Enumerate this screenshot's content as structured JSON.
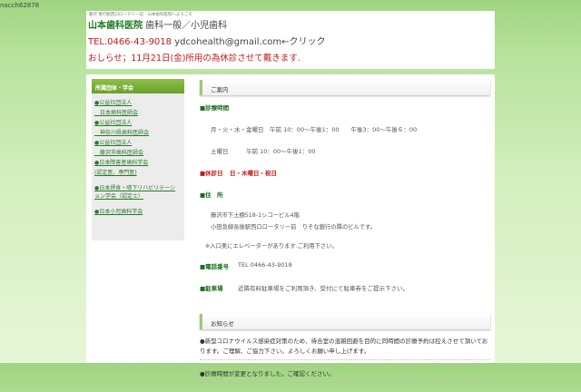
{
  "username": "nacch62878",
  "header": {
    "tagline": "藤沢 善行駅西口ロータリー前　山本歯科医院へようこそ",
    "clinic_name": "山本歯科医院",
    "clinic_sub": " 歯科一般／小児歯科",
    "tel": "TEL.0466-43-9018",
    "email": "ydcohealth@gmail.com←クリック",
    "notice": "おしらせ；11月21日(金)所用の為休診させて戴きます."
  },
  "sidebar": {
    "title": "所属団体・学会",
    "items": [
      "●公益社団法人",
      "　日本歯科医師会",
      "●公益社団法人",
      "　神奈川県歯科医師会",
      "●公益社団法人",
      "　藤沢市歯科医師会",
      "●日本障害者歯科学会",
      "(認定医、専門医)",
      "●日本摂食・嚥下リハビリテーション学会（認定士）",
      "●日本小児歯科学会"
    ]
  },
  "guide": {
    "title": "ご案内",
    "hours_label": "■診療時間",
    "hours": [
      "月・火・水・金曜日　午前 10：00〜午後1：00　　午後3：00〜午後６：00",
      "土曜日　　　午前 10：00〜午後1：00"
    ],
    "holiday_label": "■休診日",
    "holiday": "日・木曜日・祝日",
    "address_label": "■住　所",
    "address": [
      "藤沢市下土棚518-1シコービル4階",
      "小田急線長後駅西口ロータリー前　りそな銀行の隣のビルです。"
    ],
    "elevator": "※入口奥にエレベーターがあります.ご利用下さい。",
    "phone_label": "■電話番号",
    "phone": "TEL 0466-43-9018",
    "parking_label": "■駐車場",
    "parking": "近隣有料駐車場をご利用頂き、受付にて駐車券をご提示下さい。"
  },
  "news": {
    "title": "お知らせ",
    "items": [
      "●新型コロナウイルス感染症対策のため、待合室の混雑回避を目的に同時間の診療予約は控えさせて頂いております。ご理解、ご協力下さい。よろしくお願い申し上げます。",
      "●診療時間が変更となりました。ご確認ください。"
    ]
  }
}
